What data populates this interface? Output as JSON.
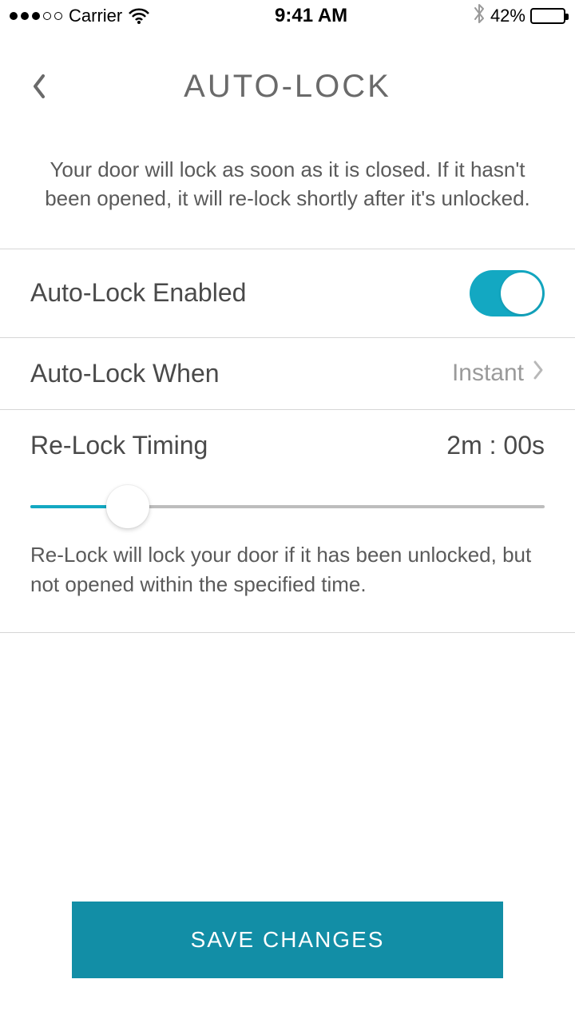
{
  "status": {
    "carrier": "Carrier",
    "time": "9:41 AM",
    "battery_pct": "42%"
  },
  "header": {
    "title": "AUTO-LOCK"
  },
  "intro": "Your door will lock as soon as it is closed. If it hasn't been opened, it will re-lock shortly after it's unlocked.",
  "settings": {
    "auto_lock_enabled": {
      "label": "Auto-Lock Enabled",
      "value": true
    },
    "auto_lock_when": {
      "label": "Auto-Lock When",
      "value": "Instant"
    },
    "relock": {
      "label": "Re-Lock Timing",
      "value": "2m : 00s",
      "slider_fraction": 0.19,
      "description": "Re-Lock will lock your door if it has been unlocked, but not opened within the specified time."
    }
  },
  "actions": {
    "save": "SAVE CHANGES"
  },
  "colors": {
    "accent": "#13a8c2",
    "save_bg": "#128ea6"
  }
}
